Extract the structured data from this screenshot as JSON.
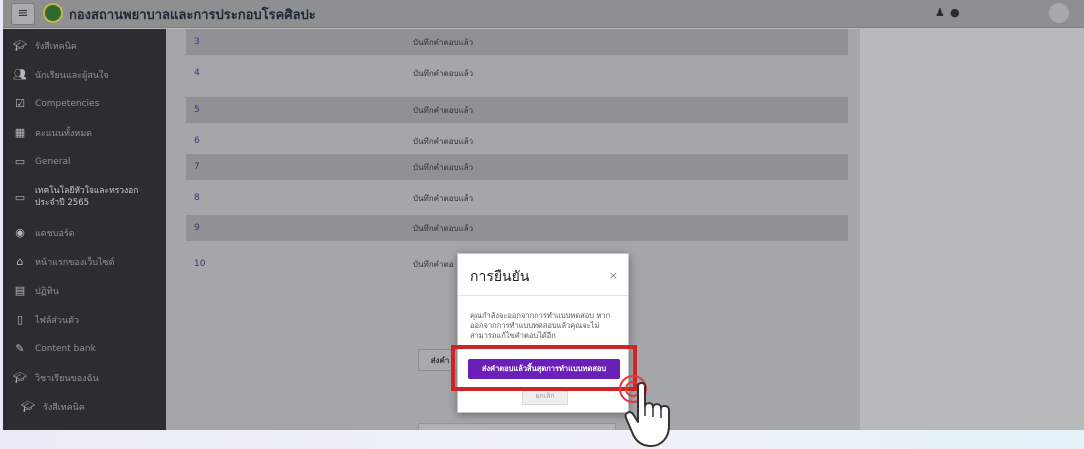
{
  "topbar": {
    "menu_icon": "hamburger-icon",
    "site_title": "กองสถานพยาบาลและการประกอบโรคศิลปะ",
    "bell_icon": "bell-icon",
    "chat_icon": "chat-icon",
    "avatar_icon": "user-avatar-icon"
  },
  "sidebar": {
    "items": [
      {
        "label": "รังสีเทคนิค",
        "icon": "graduation-cap-icon"
      },
      {
        "label": "นักเรียนและผู้สนใจ",
        "icon": "users-icon"
      },
      {
        "label": "Competencies",
        "icon": "checkbox-icon"
      },
      {
        "label": "คะแนนทั้งหมด",
        "icon": "table-icon"
      },
      {
        "label": "General",
        "icon": "folder-icon"
      },
      {
        "label": "เทคโนโลยีหัวใจและทรวงอก ประจำปี 2565",
        "icon": "folder-icon"
      },
      {
        "label": "แดชบอร์ด",
        "icon": "dashboard-icon"
      },
      {
        "label": "หน้าแรกของเว็บไซต์",
        "icon": "home-icon"
      },
      {
        "label": "ปฏิทิน",
        "icon": "calendar-icon"
      },
      {
        "label": "ไฟล์ส่วนตัว",
        "icon": "file-icon"
      },
      {
        "label": "Content bank",
        "icon": "pen-icon"
      },
      {
        "label": "วิชาเรียนของฉัน",
        "icon": "graduation-cap-icon"
      },
      {
        "label": "รังสีเทคนิค",
        "icon": "graduation-cap-icon"
      }
    ]
  },
  "quiz": {
    "rows": [
      {
        "num": "3",
        "status": "บันทึกคำตอบแล้ว"
      },
      {
        "num": "4",
        "status": "บันทึกคำตอบแล้ว"
      },
      {
        "num": "5",
        "status": "บันทึกคำตอบแล้ว"
      },
      {
        "num": "6",
        "status": "บันทึกคำตอบแล้ว"
      },
      {
        "num": "7",
        "status": "บันทึกคำตอบแล้ว"
      },
      {
        "num": "8",
        "status": "บันทึกคำตอบแล้ว"
      },
      {
        "num": "9",
        "status": "บันทึกคำตอบแล้ว"
      },
      {
        "num": "10",
        "status": "บันทึกคำตอ"
      }
    ],
    "submit_partial_label": "ส่งคำ"
  },
  "modal": {
    "title": "การยืนยัน",
    "close": "×",
    "body": "คุณกำลังจะออกจากการทำแบบทดสอบ หากออกจากการทำแบบทดสอบแล้วคุณจะไม่สามารถแก้ไขคำตอบได้อีก",
    "confirm_label": "ส่งคำตอบแล้วสิ้นสุดการทำแบบทดสอบ",
    "cancel_label": "ยกเลิก"
  },
  "colors": {
    "confirm_button": "#6a20b8",
    "highlight": "#d02424",
    "sidebar_bg": "#2a2e32"
  }
}
